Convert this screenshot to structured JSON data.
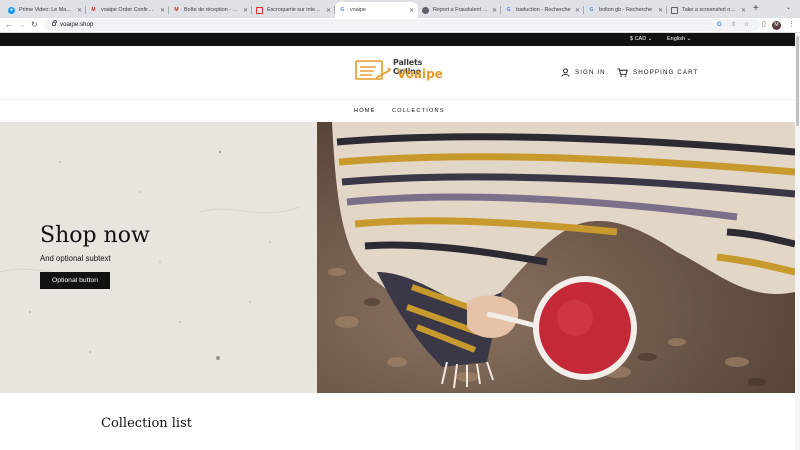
{
  "browser": {
    "tabs": [
      {
        "title": "Prime Video: Le Maître",
        "favicon": "prime-video-icon",
        "color": "#1a98ff"
      },
      {
        "title": "voaipe Order Confirmed",
        "favicon": "gmail-icon",
        "color": "#d93025"
      },
      {
        "title": "Boîte de réception - lucy",
        "favicon": "gmail-icon",
        "color": "#d93025"
      },
      {
        "title": "Escroquerie sur internet",
        "favicon": "gov-icon",
        "color": "#d93025"
      },
      {
        "title": "voaipe",
        "favicon": "google-icon",
        "color": "#4285f4"
      },
      {
        "title": "Report a Fraudulent Site",
        "favicon": "bitdefender-icon",
        "color": "#5f6368"
      },
      {
        "title": "traduction - Recherche",
        "favicon": "google-icon",
        "color": "#4285f4"
      },
      {
        "title": "bolton gb - Recherche",
        "favicon": "google-icon",
        "color": "#4285f4"
      },
      {
        "title": "Take a screenshot on y",
        "favicon": "doc-icon",
        "color": "#5f6368"
      }
    ],
    "active_tab_index": 4,
    "new_tab": "+",
    "tab_menu": "⌄",
    "url": "voaipe.shop",
    "profile_initial": "M"
  },
  "store": {
    "currency": "$ CAD",
    "language": "English",
    "logo_line1": "Pallets Online",
    "logo_line2": "Voaipe",
    "sign_in": "SIGN IN",
    "cart": "SHOPPING CART",
    "nav": [
      "HOME",
      "COLLECTIONS"
    ],
    "hero_title": "Shop now",
    "hero_subtext": "And optional subtext",
    "hero_button": "Optional button",
    "section_title": "Collection list"
  },
  "colors": {
    "accent": "#e39a2b",
    "dark": "#121212",
    "hero_left_bg": "#e8e4de"
  }
}
